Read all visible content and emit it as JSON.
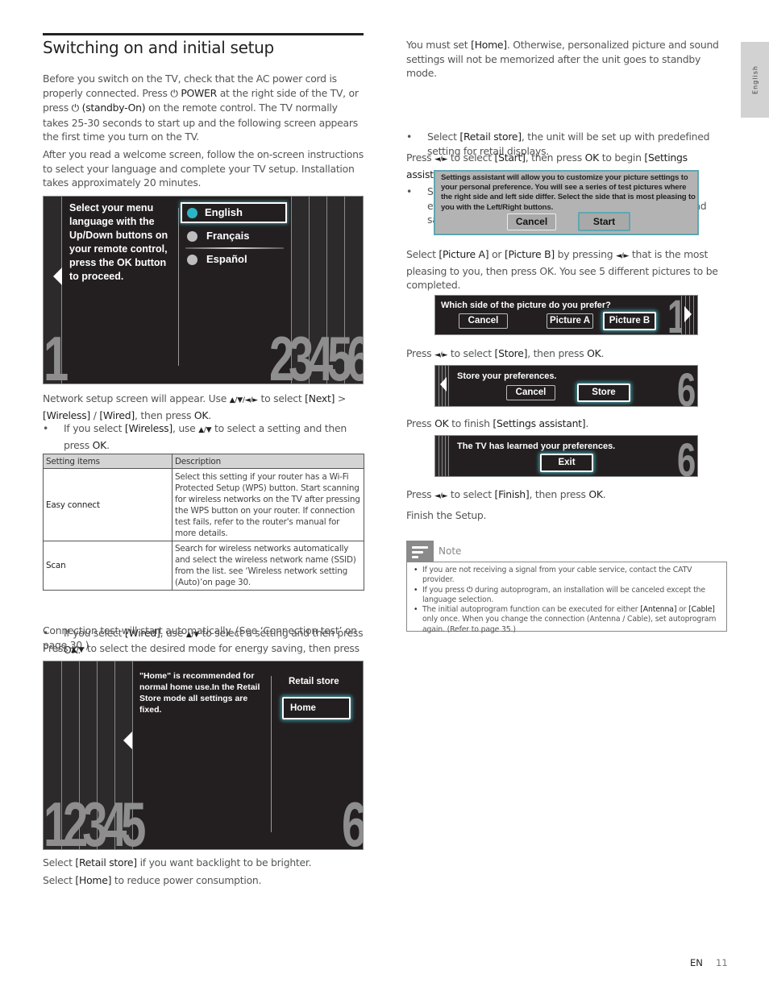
{
  "side_tab": {
    "label": "English"
  },
  "left": {
    "title": "Switching on and initial setup",
    "intro": {
      "t1": "Before you switch on the TV, check that the AC power cord is properly connected. Press ",
      "power_icon": "⏻",
      "power_label": "POWER",
      "t2": " at the right side of the TV, or press ",
      "standby_label": "(standby-On)",
      "t3": " on the remote control. The TV normally takes 25-30 seconds to start up and the following screen appears the first time you turn on the TV."
    },
    "after_read": "After you read a welcome screen, follow the on-screen instructions to select your language and complete your TV setup. Installation takes approximately 20 minutes.",
    "language_screen": {
      "instruction": "Select your menu language with the Up/Down buttons on your remote control, press the OK button to proceed.",
      "options": [
        {
          "label": "English",
          "selected": true,
          "dot_color": "#2bb5c4"
        },
        {
          "label": "Français",
          "selected": false,
          "dot_color": "#bdbdbd"
        },
        {
          "label": "Español",
          "selected": false,
          "dot_color": "#bdbdbd"
        }
      ],
      "step_left": "1",
      "steps_right": "23456"
    },
    "network": {
      "t1": "Network setup screen will appear. Use ",
      "arrows4": "▲/▼/◄/►",
      "t2": " to select ",
      "next": "[Next]",
      "gt": " > ",
      "wireless": "[Wireless]",
      "slash": " / ",
      "wired": "[Wired]",
      "t3": ", then press ",
      "ok": "OK",
      "t4": "."
    },
    "bullet_wireless": {
      "t1": "If you select ",
      "wireless": "[Wireless]",
      "t2": ", use ",
      "arrows": "▲/▼",
      "t3": " to select a setting and then press ",
      "ok": "OK",
      "t4": "."
    },
    "table": {
      "headers": [
        "Setting items",
        "Description"
      ],
      "rows": [
        {
          "item": "Easy connect",
          "desc": "Select this setting if your router has a Wi-Fi Protected Setup (WPS) button. Start scanning for wireless networks on the TV after pressing the WPS button on your router. If connection test fails, refer to the router's manual for more details."
        },
        {
          "item": "Scan",
          "desc": "Search for wireless networks automatically and select the wireless network name (SSID) from the list. see ‘Wireless network setting (Auto)’on page 30."
        }
      ]
    },
    "bullet_wired": {
      "t1": "If you select ",
      "wired": "[Wired]",
      "t2": ", use ",
      "arrows": "▲/▼",
      "t3": " to select a setting and then press ",
      "ok": "OK",
      "t4": "."
    },
    "connection_test": "Connection test will start automatically. (See ‘Connection test’ on page 30.)",
    "energy": {
      "t1": "Press ",
      "arrows": "▲/▼",
      "t2": " to select the desired mode for energy saving, then press ",
      "ok": "OK",
      "t3": "."
    },
    "energy_screen": {
      "text": "\"Home\" is recommended for normal home use.In the Retail Store mode all settings are fixed.",
      "options": [
        {
          "label": "Retail store",
          "selected": false
        },
        {
          "label": "Home",
          "selected": true
        }
      ],
      "steps_left": "12345",
      "step_right": "6"
    },
    "select_retail": {
      "t1": "Select ",
      "k": "[Retail store]",
      "t2": " if you want backlight to be brighter."
    },
    "select_home": {
      "t1": "Select ",
      "k": "[Home]",
      "t2": " to reduce power consumption."
    }
  },
  "right": {
    "must_set": {
      "t1": "You must set ",
      "k": "[Home]",
      "t2": ". Otherwise, personalized picture and sound settings will not be memorized after the unit goes to standby mode."
    },
    "bullet_retail": {
      "t1": "Select ",
      "k": "[Retail store]",
      "t2": ", the unit will be set up with predefined setting for retail displays."
    },
    "bullet_home": {
      "t1": "Select ",
      "k": "[Home]",
      "t2": ", the unit will be set to maximize energy efficiency. Picture and sound settings can be adjusted and saved as per your personal preferences."
    },
    "press_start": {
      "t1": "Press ",
      "arrows": "◄/►",
      "t2": " to select ",
      "k1": "[Start]",
      "t3": ", then press ",
      "ok": "OK",
      "t4": " to begin ",
      "k2": "[Settings assistant]",
      "t5": "."
    },
    "assistant_dialog": {
      "text": "Settings assistant will allow you to customize your picture settings to your personal preference. You will see a series of test pictures where the right side and left side differ. Select the side that is most pleasing to you with the Left/Right buttons.",
      "cancel": "Cancel",
      "start": "Start"
    },
    "select_picture": {
      "t1": "Select ",
      "k1": "[Picture A]",
      "t2": " or ",
      "k2": "[Picture B]",
      "t3": " by pressing ",
      "arrows": "◄/►",
      "t4": " that is the most pleasing to you, then press OK. You see 5 different pictures to be completed."
    },
    "picture_screen": {
      "question": "Which side of the picture do you prefer?",
      "cancel": "Cancel",
      "a": "Picture A",
      "b": "Picture B",
      "step": "1"
    },
    "press_store": {
      "t1": "Press ",
      "arrows": "◄/►",
      "t2": " to select ",
      "k": "[Store]",
      "t3": ", then press ",
      "ok": "OK",
      "t4": "."
    },
    "store_screen": {
      "text": "Store your preferences.",
      "cancel": "Cancel",
      "store": "Store",
      "step": "6"
    },
    "press_ok_finish": {
      "t1": "Press ",
      "ok": "OK",
      "t2": " to finish ",
      "k": "[Settings assistant]",
      "t3": "."
    },
    "learned_screen": {
      "text": "The TV has learned your preferences.",
      "exit": "Exit",
      "step": "6"
    },
    "press_finish": {
      "t1": "Press ",
      "arrows": "◄/►",
      "t2": " to select ",
      "k": "[Finish]",
      "t3": ", then press ",
      "ok": "OK",
      "t4": "."
    },
    "finish_setup": "Finish the Setup.",
    "note": {
      "title": "Note",
      "items": [
        {
          "t1": "If you are not receiving a signal from your cable service, contact the CATV provider."
        },
        {
          "t1": "If you press ",
          "icon": "⏻",
          "t2": " during autoprogram, an installation will be canceled except the language selection."
        },
        {
          "t1": "The initial autoprogram function can be executed for either ",
          "k1": "[Antenna]",
          "t2": " or ",
          "k2": "[Cable]",
          "t3": " only once. When you change the connection (Antenna / Cable), set autoprogram again. (Refer to page 35.)"
        }
      ]
    }
  },
  "footer": {
    "lang": "EN",
    "page": "11"
  }
}
